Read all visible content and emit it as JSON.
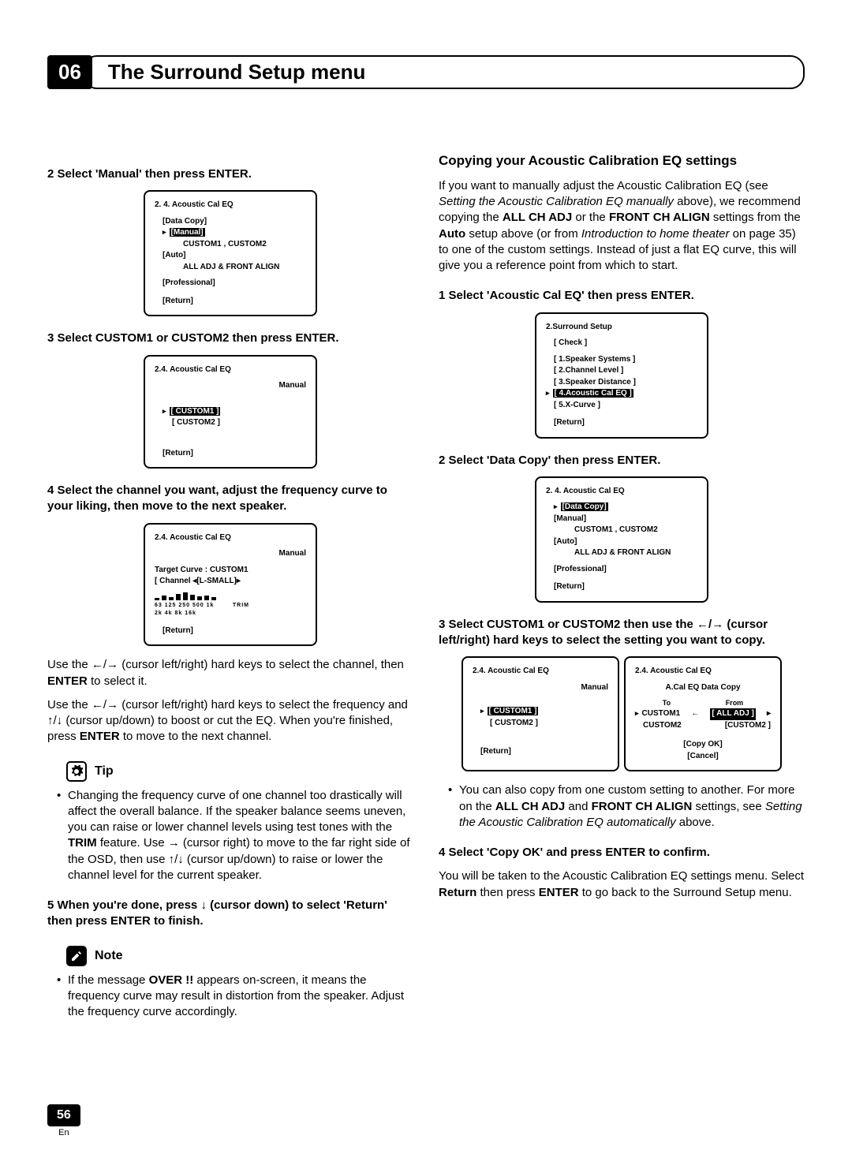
{
  "chapter": {
    "num": "06",
    "title": "The Surround Setup menu"
  },
  "left": {
    "step2": "2    Select 'Manual' then press ENTER.",
    "osd1": {
      "title": "2. 4. Acoustic  Cal   EQ",
      "data_copy": "[Data Copy]",
      "manual": "[Manual]",
      "custom_line": "CUSTOM1 ,  CUSTOM2",
      "auto": "[Auto]",
      "all_adj": "ALL ADJ & FRONT ALIGN",
      "professional": "[Professional]",
      "return": "[Return]"
    },
    "step3": "3    Select CUSTOM1 or CUSTOM2 then press ENTER.",
    "osd2": {
      "title": "2.4. Acoustic  Cal   EQ",
      "sub": "Manual",
      "c1": "[ CUSTOM1 ]",
      "c2": "[  CUSTOM2  ]",
      "return": "[Return]"
    },
    "step4": "4    Select the channel you want, adjust the frequency curve to your liking, then move to the next speaker.",
    "osd3": {
      "title": "2.4. Acoustic  Cal   EQ",
      "sub": "Manual",
      "target": "Target Curve : CUSTOM1",
      "channel": "[ Channel   ◂[L-SMALL]▸",
      "freqs": "63 125 250 500 1k 2k 4k 8k 16k",
      "trim": "TRIM",
      "return": "[Return]"
    },
    "para_a_pre": "Use the ",
    "para_a_mid": " (cursor left/right) hard keys to select the channel, then ",
    "para_a_enter": "ENTER",
    "para_a_post": " to select it.",
    "para_b_pre": "Use the ",
    "para_b_mid1": " (cursor left/right) hard keys to select the frequency and ",
    "para_b_mid2": " (cursor up/down) to boost or cut the EQ. When you're finished, press ",
    "para_b_enter": "ENTER",
    "para_b_post": " to move to the next channel.",
    "tip_label": "Tip",
    "tip_body_pre": "Changing the frequency curve of one channel too drastically will affect the overall balance. If the speaker balance seems uneven, you can raise or lower channel levels using test tones with the ",
    "tip_trim": "TRIM",
    "tip_body_mid1": " feature. Use ",
    "tip_body_mid2": " (cursor right) to move to the far right side of the OSD, then use ",
    "tip_body_mid3": " (cursor up/down) to raise or lower the channel level for the current speaker.",
    "step5_a": "5    When you're done, press ",
    "step5_b": " (cursor down) to select 'Return' then press ENTER to finish.",
    "note_label": "Note",
    "note_body_pre": "If the message ",
    "note_over": "OVER !!",
    "note_body_post": " appears on-screen, it means the frequency curve may result in distortion from the speaker. Adjust the frequency curve accordingly."
  },
  "right": {
    "h": "Copying your Acoustic Calibration EQ settings",
    "intro_a": "If you want to manually adjust the Acoustic Calibration EQ (see ",
    "intro_i1": "Setting the Acoustic Calibration EQ manually",
    "intro_b": " above), we recommend copying the ",
    "intro_all": "ALL CH ADJ",
    "intro_c": " or the ",
    "intro_front": "FRONT CH ALIGN",
    "intro_d": " settings from the ",
    "intro_auto": "Auto",
    "intro_e": " setup above (or from ",
    "intro_i2": "Introduction to home theater",
    "intro_f": " on page 35) to one of the custom settings. Instead of just a flat EQ curve, this will give you a reference point from which to start.",
    "step1": "1    Select 'Acoustic Cal EQ' then press ENTER.",
    "osd1": {
      "title": "2.Surround Setup",
      "check": "[  Check  ]",
      "l1": "[  1.Speaker Systems  ]",
      "l2": "[  2.Channel Level  ]",
      "l3": "[  3.Speaker Distance  ]",
      "l4": "[  4.Acoustic Cal EQ  ]",
      "l5": "[  5.X-Curve  ]",
      "return": "[Return]"
    },
    "step2": "2    Select 'Data Copy' then press ENTER.",
    "osd2": {
      "title": "2. 4. Acoustic  Cal   EQ",
      "data_copy": "[Data Copy]",
      "manual": "[Manual]",
      "custom_line": "CUSTOM1 ,  CUSTOM2",
      "auto": "[Auto]",
      "all_adj": "ALL ADJ & FRONT ALIGN",
      "professional": "[Professional]",
      "return": "[Return]"
    },
    "step3_a": "3    Select CUSTOM1 or CUSTOM2 then use the ",
    "step3_b": " (cursor left/right) hard keys to select the setting you want to copy.",
    "osd3a": {
      "title": "2.4. Acoustic  Cal   EQ",
      "sub": "Manual",
      "c1": "[ CUSTOM1 ]",
      "c1b": "CUSTOM1",
      "c2": "[  CUSTOM2  ]",
      "c2b": "CUSTOM2",
      "return": "[Return]"
    },
    "osd3b": {
      "title": "2.4. Acoustic  Cal   EQ",
      "sub": "A.Cal EQ Data Copy",
      "to": "To",
      "from": "From",
      "alladj": "[ ALL ADJ ]",
      "cust2": "[CUSTOM2 ]",
      "copyok": "[Copy OK]",
      "cancel": "[Cancel]"
    },
    "bullet_a": "You can also copy from one custom setting to another. For more on the ",
    "bullet_all": "ALL CH ADJ",
    "bullet_and": " and ",
    "bullet_front": "FRONT CH ALIGN",
    "bullet_b": " settings, see ",
    "bullet_i": "Setting the Acoustic Calibration EQ automatically",
    "bullet_c": " above.",
    "step4": "4    Select 'Copy OK' and press ENTER to confirm.",
    "outro_a": "You will be taken to the Acoustic Calibration EQ settings menu. Select ",
    "outro_ret": "Return",
    "outro_b": " then press ",
    "outro_ent": "ENTER",
    "outro_c": " to go back to the Surround Setup menu."
  },
  "footer": {
    "page": "56",
    "lang": "En"
  },
  "glyphs": {
    "left": "←",
    "right": "→",
    "up": "↑",
    "down": "↓",
    "slash": "/"
  }
}
